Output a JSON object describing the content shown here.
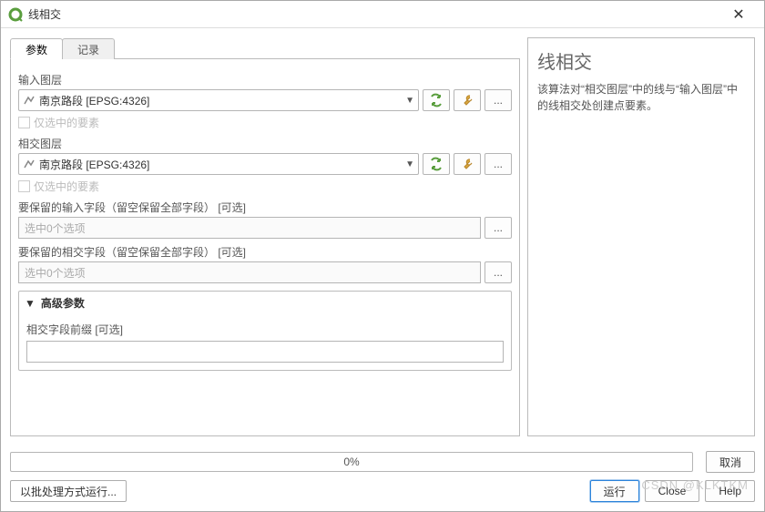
{
  "window": {
    "title": "线相交"
  },
  "tabs": {
    "params": "参数",
    "log": "记录"
  },
  "form": {
    "input_layer_label": "输入图层",
    "input_layer_value": "南京路段 [EPSG:4326]",
    "only_selected": "仅选中的要素",
    "intersect_layer_label": "相交图层",
    "intersect_layer_value": "南京路段 [EPSG:4326]",
    "keep_input_fields_label": "要保留的输入字段（留空保留全部字段） [可选]",
    "keep_input_fields_value": "选中0个选项",
    "keep_intersect_fields_label": "要保留的相交字段（留空保留全部字段） [可选]",
    "keep_intersect_fields_value": "选中0个选项",
    "advanced_header": "高级参数",
    "prefix_label": "相交字段前缀 [可选]"
  },
  "help": {
    "title": "线相交",
    "desc": "该算法对“相交图层”中的线与“输入图层”中的线相交处创建点要素。"
  },
  "progress": {
    "text": "0%"
  },
  "buttons": {
    "cancel": "取消",
    "batch": "以批处理方式运行...",
    "run": "运行",
    "close": "Close",
    "help": "Help"
  },
  "watermark": "CSDN @KLKTKM"
}
